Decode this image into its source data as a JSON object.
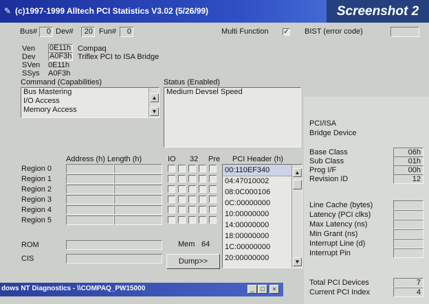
{
  "window": {
    "title": "(c)1997-1999 Alltech PCI Statistics V3.02 (5/26/99)",
    "badge": "Screenshot 2"
  },
  "top": {
    "bus_label": "Bus#",
    "bus_value": "0",
    "dev_label": "Dev#",
    "dev_value": "20",
    "fun_label": "Fun#",
    "fun_value": "0",
    "multi_function_label": "Multi Function",
    "multi_function_checked": true,
    "bist_label": "BIST (error code)"
  },
  "ids": {
    "ven_label": "Ven",
    "ven_value": "0E11h",
    "ven_desc": "Compaq",
    "dev_label": "Dev",
    "dev_value": "A0F3h",
    "dev_desc": "Triflex PCI to ISA Bridge",
    "sven_label": "SVen",
    "sven_value": "0E11h",
    "ssys_label": "SSys",
    "ssys_value": "A0F3h"
  },
  "command": {
    "label": "Command (Capabilities)",
    "items": [
      "Bus Mastering",
      "I/O Access",
      "Memory Access"
    ]
  },
  "status": {
    "label": "Status (Enabled)",
    "items": [
      "Medium Devsel Speed"
    ]
  },
  "regions": {
    "col_address": "Address (h)",
    "col_length": "Length (h)",
    "col_io": "IO",
    "col_32": "32",
    "col_pre": "Pre",
    "rows": [
      "Region 0",
      "Region 1",
      "Region 2",
      "Region 3",
      "Region 4",
      "Region 5"
    ],
    "rom_label": "ROM",
    "cis_label": "CIS",
    "mem_label": "Mem",
    "mem_value": "64"
  },
  "header": {
    "label": "PCI Header (h)",
    "rows": [
      "00:110EF340",
      "04:47010002",
      "08:0C000106",
      "0C:00000000",
      "10:00000000",
      "14:00000000",
      "18:00000000",
      "1C:00000000",
      "20:00000000"
    ],
    "dump_label": "Dump>>"
  },
  "device": {
    "type_line1": "PCI/ISA",
    "type_line2": "Bridge Device",
    "base_class_label": "Base Class",
    "base_class_value": "06h",
    "sub_class_label": "Sub Class",
    "sub_class_value": "01h",
    "prog_if_label": "Prog I/F",
    "prog_if_value": "00h",
    "revision_label": "Revision ID",
    "revision_value": "12",
    "line_cache_label": "Line Cache (bytes)",
    "latency_label": "Latency (PCI clks)",
    "max_latency_label": "Max Latency (ns)",
    "min_grant_label": "Min Grant (ns)",
    "int_line_label": "Interrupt Line (d)",
    "int_pin_label": "Interrupt Pin",
    "total_label": "Total PCI Devices",
    "total_value": "7",
    "current_label": "Current PCI Index",
    "current_value": "4"
  },
  "taskbar": {
    "title": "dows NT Diagnostics - \\\\COMPAQ_PW15000"
  },
  "colors": {
    "title_start": "#1c2f9c",
    "title_end": "#5a86e6",
    "badge_bg": "#24407e",
    "window_bg": "#cdcfca"
  }
}
